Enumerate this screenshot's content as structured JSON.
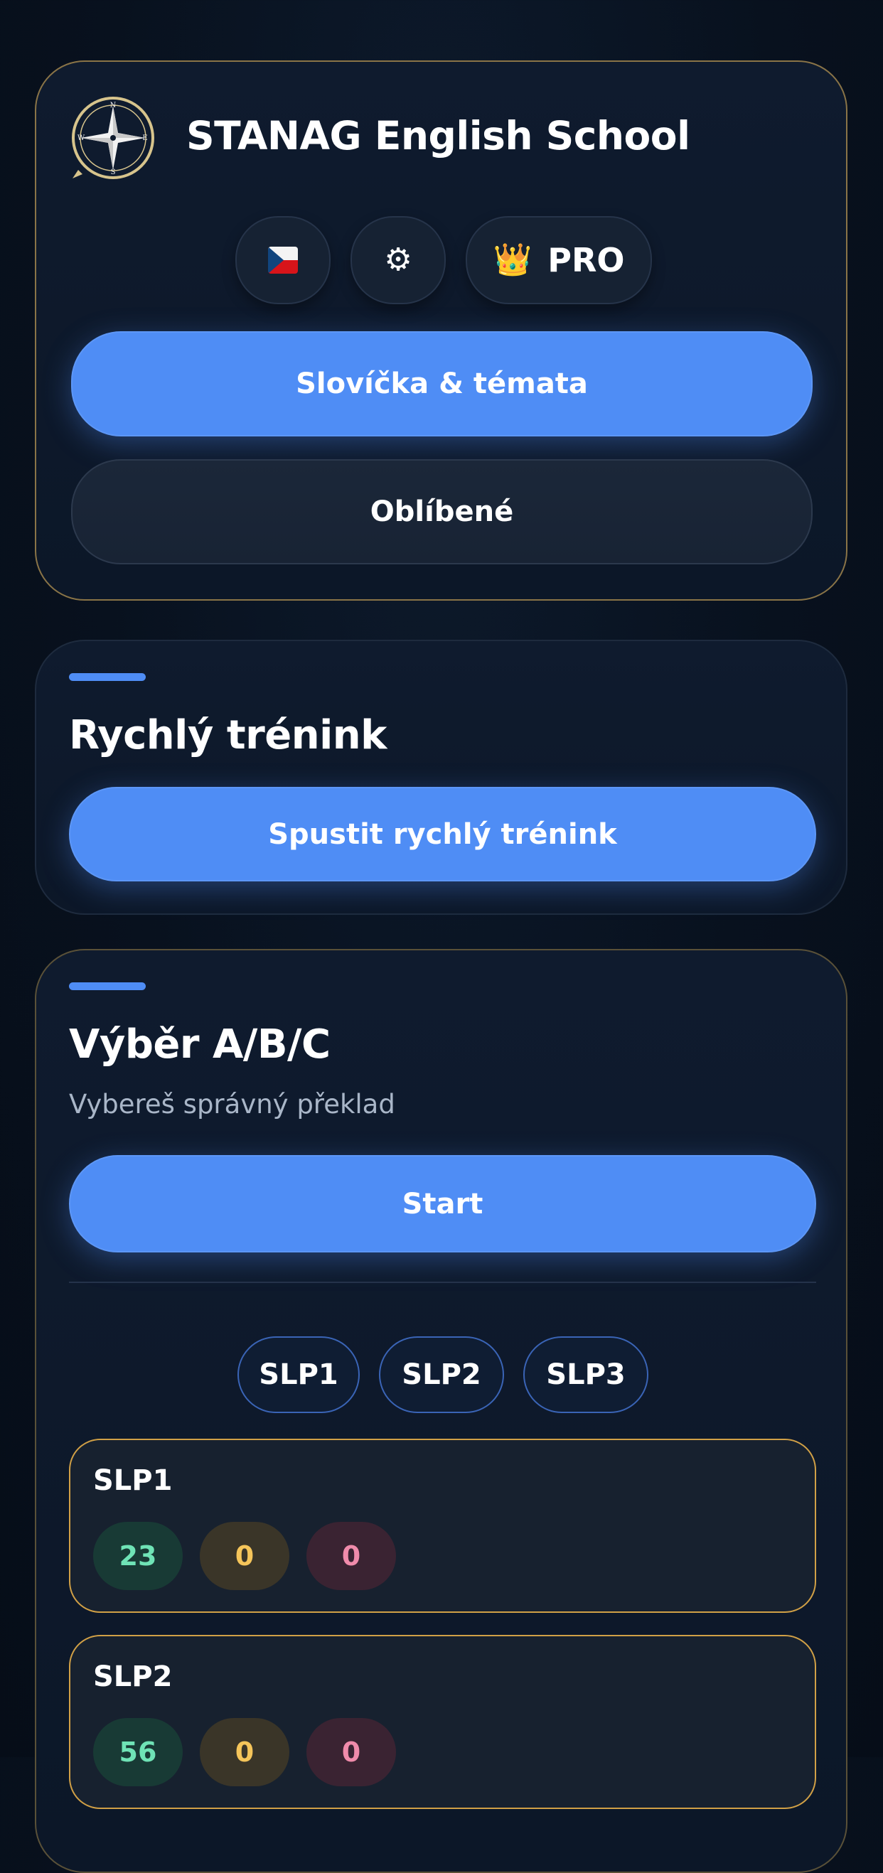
{
  "header": {
    "app_title": "STANAG English School",
    "logo_icon": "compass-rose-icon",
    "compass_letters": {
      "n": "N",
      "e": "E",
      "s": "S",
      "w": "W"
    },
    "language_icon": "czech-flag-icon",
    "settings_icon": "gear-icon",
    "settings_glyph": "⚙",
    "pro_icon": "crown-icon",
    "pro_glyph": "👑",
    "pro_label": "PRO",
    "vocab_button": "Slovíčka & témata",
    "favorites_button": "Oblíbené"
  },
  "quick_training": {
    "title": "Rychlý trénink",
    "button": "Spustit rychlý trénink"
  },
  "abc_choice": {
    "title": "Výběr A/B/C",
    "subtitle": "Vybereš správný překlad",
    "start_button": "Start",
    "level_tabs": [
      "SLP1",
      "SLP2",
      "SLP3"
    ],
    "levels": [
      {
        "name": "SLP1",
        "correct": "23",
        "partial": "0",
        "wrong": "0"
      },
      {
        "name": "SLP2",
        "correct": "56",
        "partial": "0",
        "wrong": "0"
      }
    ]
  },
  "colors": {
    "accent_blue": "#4f8df5",
    "gold_border": "#d1a046",
    "correct_green": "#6fe3b6",
    "partial_yellow": "#f5c55a",
    "wrong_pink": "#f08bab"
  }
}
